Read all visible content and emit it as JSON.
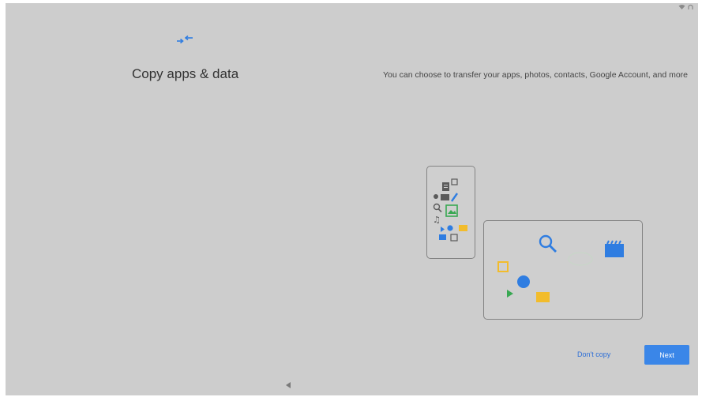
{
  "setup": {
    "title": "Copy apps & data",
    "description": "You can choose to transfer your apps, photos, contacts, Google Account, and more"
  },
  "actions": {
    "dont_copy_label": "Don't copy",
    "next_label": "Next"
  },
  "colors": {
    "accent": "#3a86e8",
    "screen_background": "#cdcdcd",
    "icon_blue": "#2f7de1",
    "icon_yellow": "#f2bc2c",
    "icon_green": "#38a852"
  },
  "icons": {
    "header": "transfer-arrows-icon",
    "status_bar": [
      "wifi-icon",
      "battery-icon"
    ],
    "navigation": "back-triangle-icon"
  }
}
